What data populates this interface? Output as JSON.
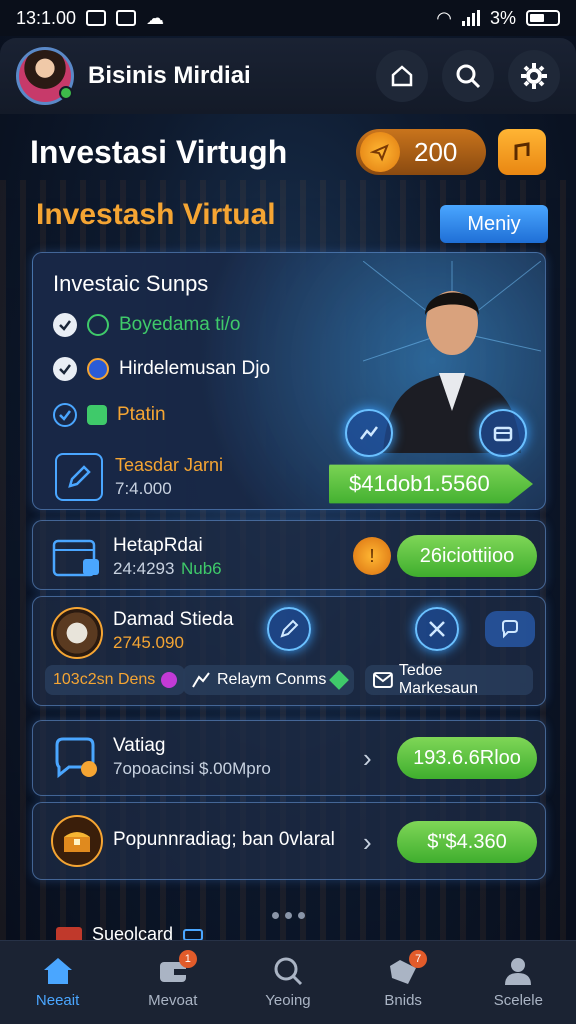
{
  "status_bar": {
    "time": "13:1.00",
    "battery": "3%"
  },
  "header": {
    "title": "Bisinis Mirdiai"
  },
  "title_row": {
    "title": "Investasi Virtugh",
    "coins": "200"
  },
  "section": {
    "title": "Investash Virtual",
    "menu_label": "Meniy"
  },
  "hero": {
    "title": "Investaic Sunps",
    "items": [
      {
        "label": "Boyedama ti/o",
        "color": "#3fca6a"
      },
      {
        "label": "Hirdelemusan Djo",
        "color": "#ffffff"
      },
      {
        "label": "Ptatin",
        "color": "#f5a533"
      }
    ],
    "subtitle": "Teasdar Jarni",
    "subvalue": "7:4.000",
    "value_button": "$41dob1.5560"
  },
  "row1": {
    "label": "HetapRdai",
    "value": "24:4293",
    "tag": "Nub6",
    "button": "26iciottiioo"
  },
  "row2": {
    "label": "Damad Stieda",
    "value": "2745.090",
    "tags": [
      "103c2sn Dens",
      "Relaym Conms",
      "Tedoe Markesaun"
    ]
  },
  "row3": {
    "label": "Vatiag",
    "sub": "7opoacinsi $.00Mpro",
    "button": "193.6.6Rloo"
  },
  "row4": {
    "label": "Popunnradiag; ban 0vlaral",
    "button": "$\"$4.360"
  },
  "peek": {
    "label": "Sueolcard"
  },
  "bottom_nav": [
    {
      "label": "Neeait",
      "icon": "home-icon",
      "active": true
    },
    {
      "label": "Mevoat",
      "icon": "wallet-icon",
      "badge": "1"
    },
    {
      "label": "Yeoing",
      "icon": "search-icon"
    },
    {
      "label": "Bnids",
      "icon": "tag-icon",
      "badge": "7"
    },
    {
      "label": "Scelele",
      "icon": "profile-icon"
    }
  ],
  "colors": {
    "accent": "#4aa6ff",
    "orange": "#f5a533",
    "green": "#3fae2e"
  }
}
